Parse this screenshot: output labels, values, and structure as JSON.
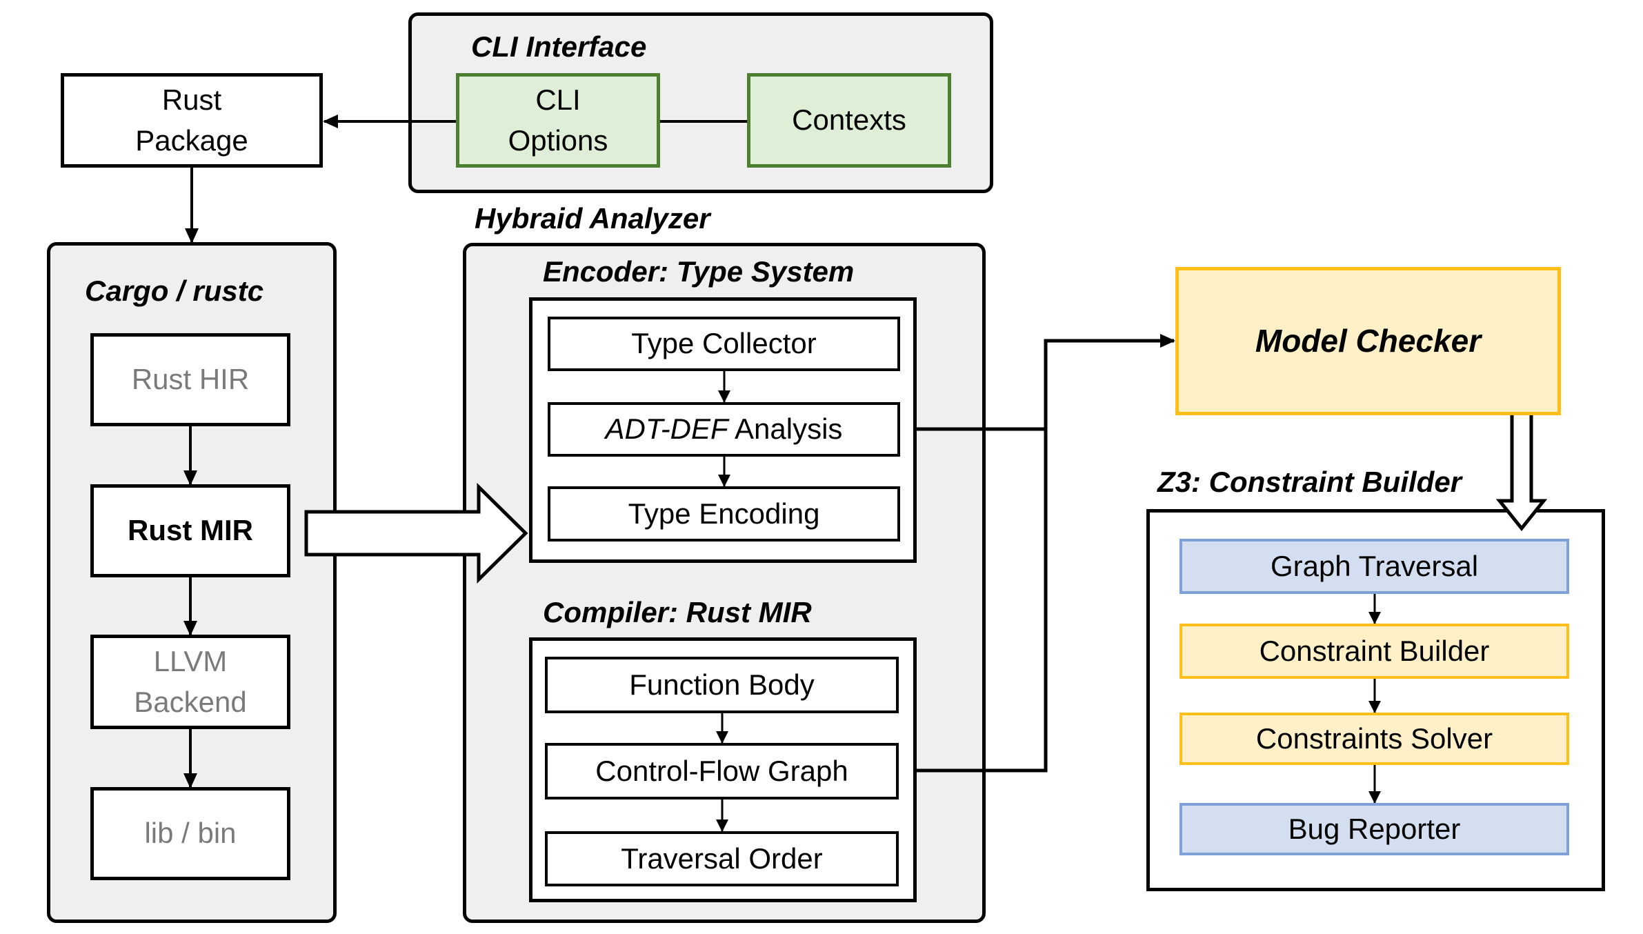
{
  "diagram": {
    "rust_package": {
      "label_line1": "Rust",
      "label_line2": "Package"
    },
    "cli_interface": {
      "title": "CLI Interface",
      "cli_options": {
        "label_line1": "CLI",
        "label_line2": "Options"
      },
      "contexts": {
        "label": "Contexts"
      }
    },
    "cargo_rustc": {
      "title": "Cargo / rustc",
      "steps": [
        {
          "label": "Rust HIR",
          "emphasis": "muted"
        },
        {
          "label": "Rust MIR",
          "emphasis": "bold"
        },
        {
          "label_line1": "LLVM",
          "label_line2": "Backend",
          "emphasis": "muted"
        },
        {
          "label": "lib / bin",
          "emphasis": "muted"
        }
      ]
    },
    "hybraid_analyzer": {
      "title": "Hybraid Analyzer",
      "encoder": {
        "title": "Encoder: Type System",
        "steps": [
          {
            "label": "Type Collector"
          },
          {
            "label_italic": "ADT-DEF",
            "label_rest": " Analysis"
          },
          {
            "label": "Type Encoding"
          }
        ]
      },
      "compiler": {
        "title": "Compiler: Rust MIR",
        "steps": [
          {
            "label": "Function Body"
          },
          {
            "label": "Control-Flow Graph"
          },
          {
            "label": "Traversal Order"
          }
        ]
      }
    },
    "model_checker": {
      "label": "Model Checker"
    },
    "z3": {
      "title": "Z3: Constraint Builder",
      "steps": [
        {
          "label": "Graph Traversal",
          "color": "blue"
        },
        {
          "label": "Constraint Builder",
          "color": "yellow"
        },
        {
          "label": "Constraints Solver",
          "color": "yellow"
        },
        {
          "label": "Bug Reporter",
          "color": "blue"
        }
      ]
    },
    "colors": {
      "group_fill": "#efefef",
      "green_fill": "#dfeed6",
      "green_border": "#4e7e30",
      "yellow_fill": "#fff0c8",
      "yellow_border": "#fdbf18",
      "blue_fill": "#d3dff0",
      "blue_border": "#7ea2d8",
      "muted_text": "#7a7a7a"
    }
  }
}
